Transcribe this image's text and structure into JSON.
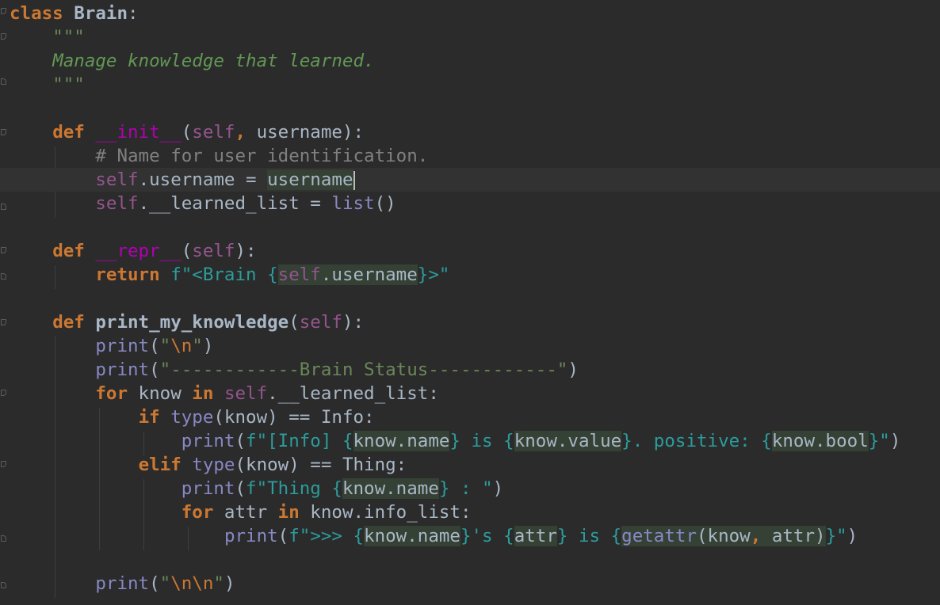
{
  "editor": {
    "language": "python",
    "colors": {
      "background": "#2b2b2b",
      "keyword": "#cc7832",
      "string": "#6a8759",
      "fstring": "#2c9c9c",
      "docstring": "#629755",
      "comment": "#808080",
      "self": "#94558d",
      "builtin": "#8888c6",
      "dunder": "#b200b2",
      "default": "#a9b7c6"
    },
    "lines": [
      "class Brain:",
      "    \"\"\"",
      "    Manage knowledge that learned.",
      "    \"\"\"",
      "",
      "    def __init__(self, username):",
      "        # Name for user identification.",
      "        self.username = username",
      "        self.__learned_list = list()",
      "",
      "    def __repr__(self):",
      "        return f\"<Brain {self.username}>\"",
      "",
      "    def print_my_knowledge(self):",
      "        print(\"\\n\")",
      "        print(\"------------Brain Status------------\")",
      "        for know in self.__learned_list:",
      "            if type(know) == Info:",
      "                print(f\"[Info] {know.name} is {know.value}. positive: {know.bool}\")",
      "            elif type(know) == Thing:",
      "                print(f\"Thing {know.name} : \")",
      "                for attr in know.info_list:",
      "                    print(f\">>> {know.name}'s {attr} is {getattr(know, attr)}\")",
      "",
      "        print(\"\\n\\n\")"
    ]
  }
}
